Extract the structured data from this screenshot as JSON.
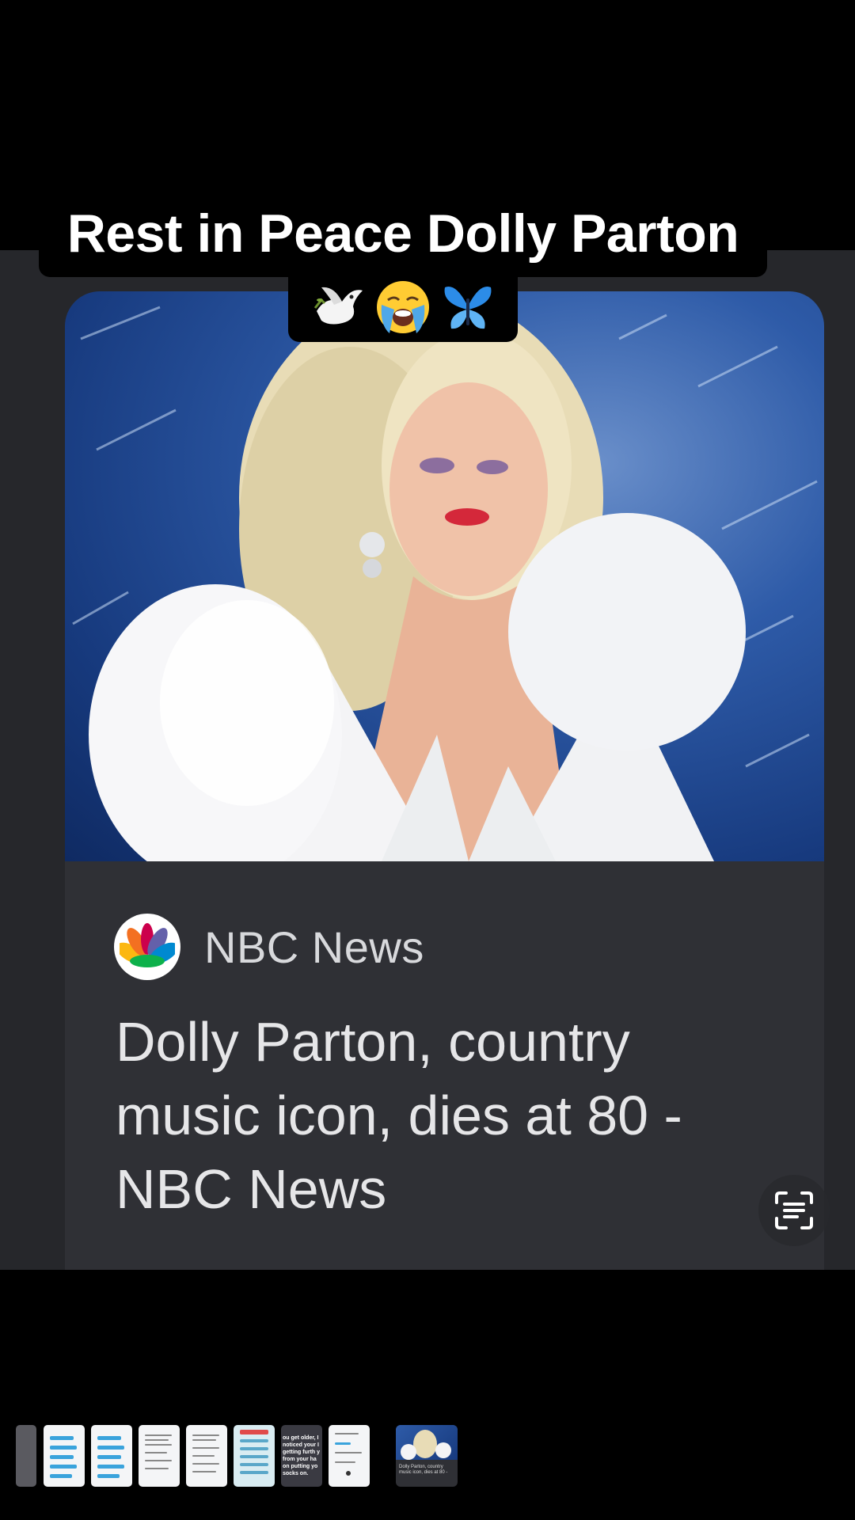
{
  "caption": {
    "line1": "Rest in Peace Dolly Parton",
    "emojis": [
      "dove-emoji",
      "crying-face-emoji",
      "butterfly-emoji"
    ]
  },
  "card": {
    "source": "NBC News",
    "headline": "Dolly Parton, country music icon, dies at 80 - NBC News",
    "photo_icon": "portrait-photo"
  },
  "lens_button": {
    "icon": "scan-text-icon"
  },
  "thumbnails": {
    "dark_thumb_text": "ou get older, I noticed your I getting furth y from your ha on putting yo socks on.",
    "selected_thumb_text": "Dolly Parton, country music icon, dies at 80 -"
  },
  "colors": {
    "background": "#000000",
    "card_bg": "#2f3035",
    "backdrop": "#26272b",
    "text_light": "#e6e6e8"
  }
}
